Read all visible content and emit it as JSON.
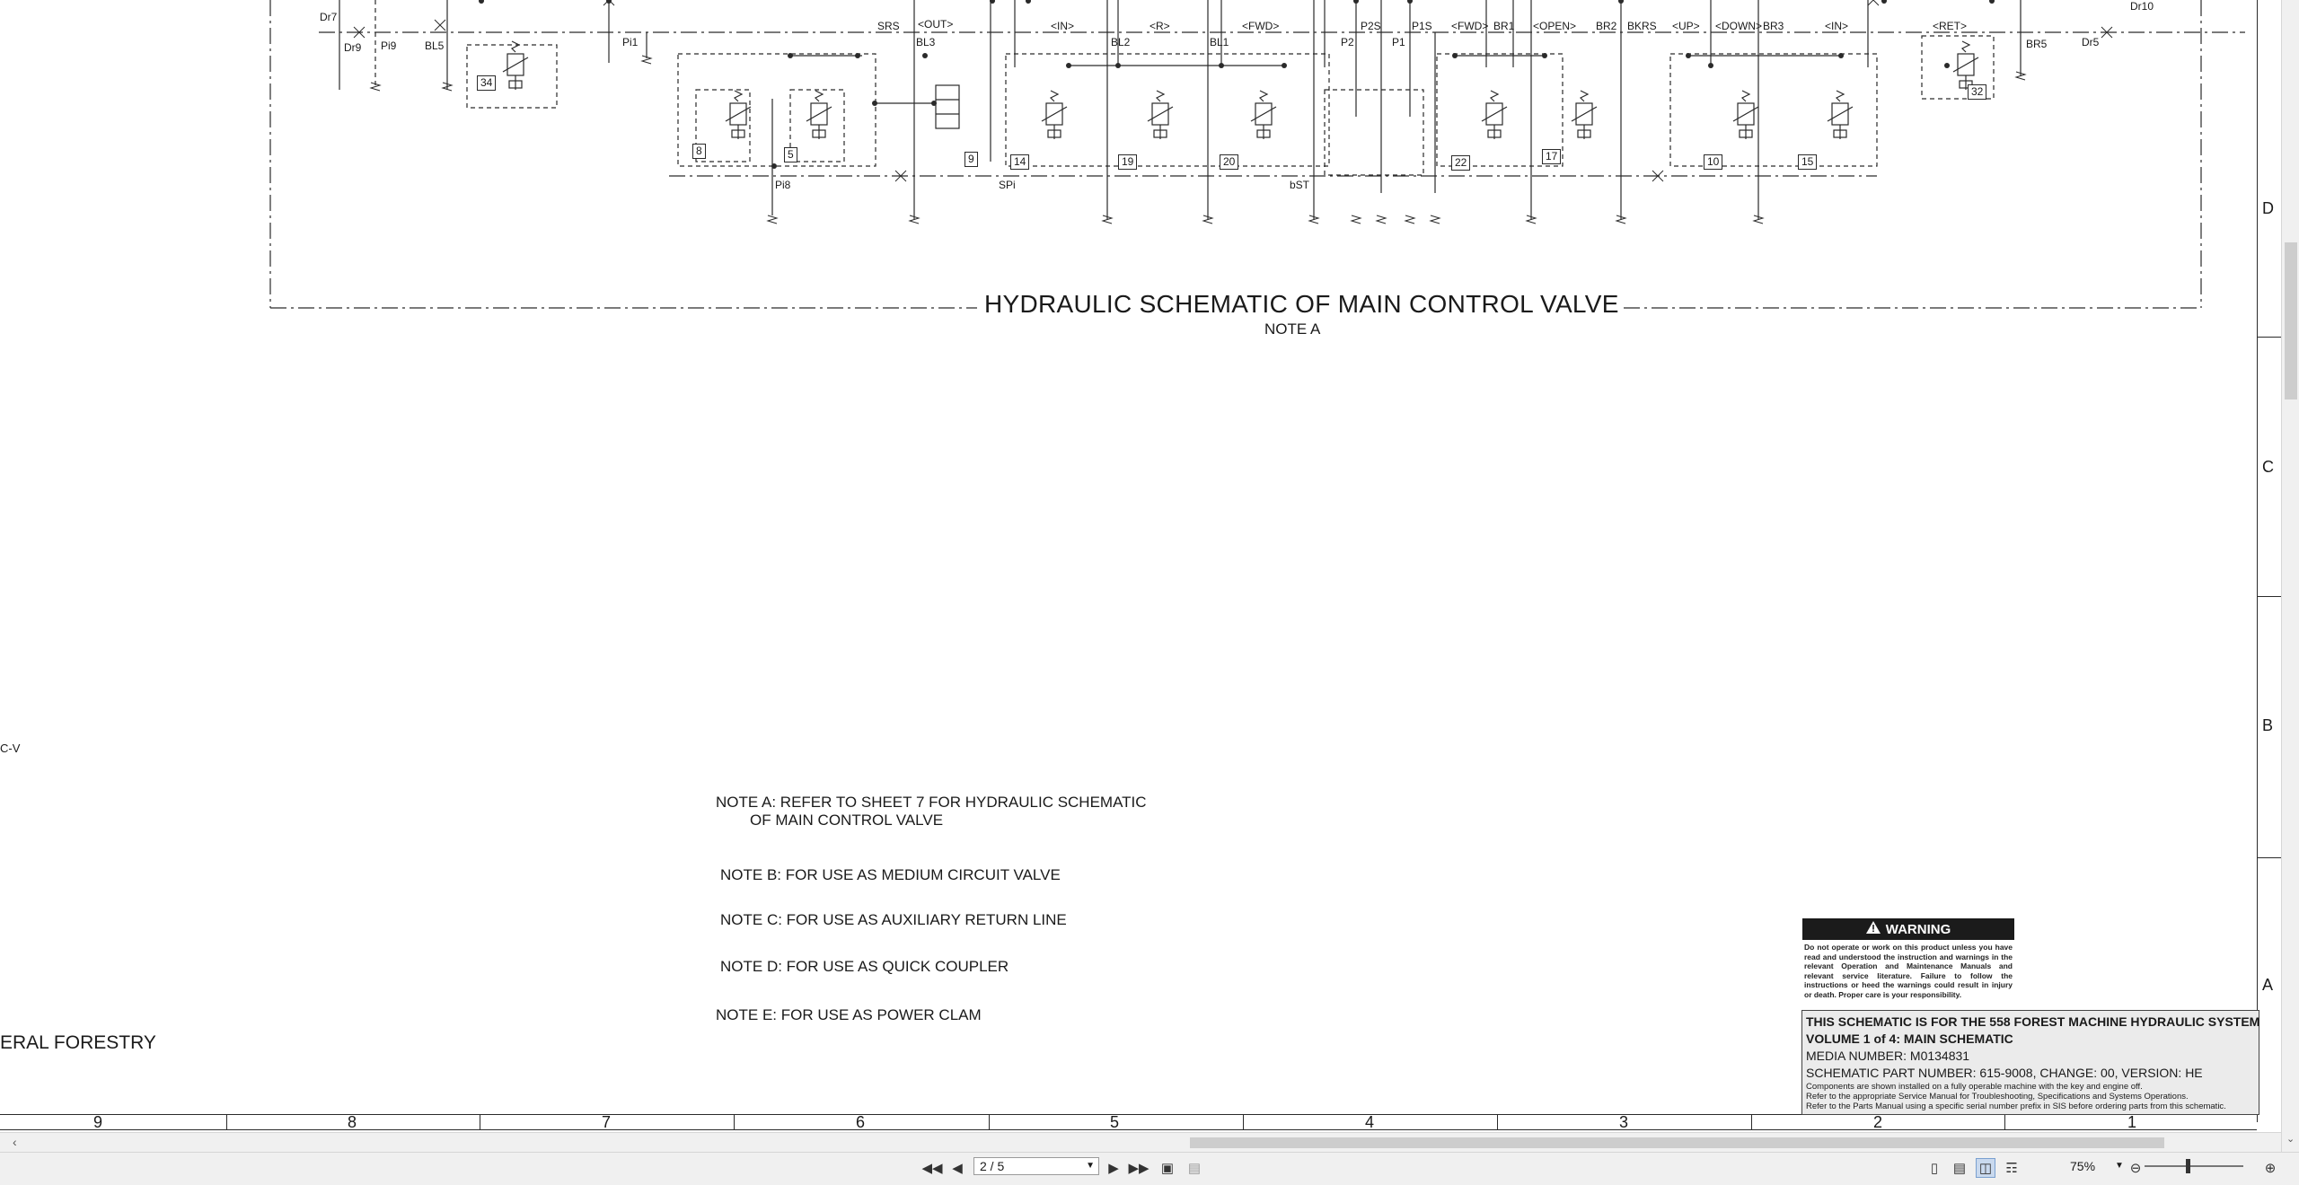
{
  "schematic": {
    "title": "HYDRAULIC SCHEMATIC OF MAIN CONTROL VALVE",
    "subtitle": "NOTE A",
    "port_labels": [
      "Dr7",
      "Dr9",
      "Pi9",
      "BL5",
      "Pi1",
      "SRS",
      "<OUT>",
      "BL3",
      "<IN>",
      "BL2",
      "<R>",
      "BL1",
      "<FWD>",
      "P2S",
      "P2",
      "P1S",
      "P1",
      "<FWD>",
      "BR1",
      "<OPEN>",
      "BR2",
      "BKRS",
      "<UP>",
      "<DOWN>",
      "BR3",
      "<IN>",
      "<RET>",
      "BR5",
      "Dr5",
      "Dr10",
      "Pi8",
      "SPi",
      "bST"
    ],
    "component_numbers": [
      "34",
      "8",
      "5",
      "9",
      "14",
      "19",
      "20",
      "22",
      "17",
      "10",
      "15",
      "32"
    ],
    "cut_text_left": "C-V",
    "cut_text_forestry": "ERAL FORESTRY"
  },
  "notes": [
    {
      "line1": "NOTE A: REFER TO SHEET 7 FOR HYDRAULIC SCHEMATIC",
      "line2": "OF MAIN CONTROL VALVE"
    },
    {
      "line1": "NOTE B: FOR USE AS MEDIUM CIRCUIT VALVE"
    },
    {
      "line1": "NOTE C: FOR USE AS AUXILIARY RETURN LINE"
    },
    {
      "line1": "NOTE D: FOR USE AS QUICK COUPLER"
    },
    {
      "line1": "NOTE E: FOR USE AS POWER CLAM"
    }
  ],
  "zones_right": [
    "D",
    "C",
    "B",
    "A"
  ],
  "columns": [
    "9",
    "8",
    "7",
    "6",
    "5",
    "4",
    "3",
    "2",
    "1"
  ],
  "warning": {
    "heading": "WARNING",
    "body": "Do not operate or work on this product unless you have read and understood the instruction and warnings in the relevant Operation and Maintenance Manuals and relevant service literature. Failure to follow the instructions or heed the warnings could result in injury or death. Proper care is your responsibility."
  },
  "info_block": {
    "title": "THIS SCHEMATIC IS FOR THE 558 FOREST MACHINE HYDRAULIC SYSTEM",
    "volume": "VOLUME 1 of 4: MAIN SCHEMATIC",
    "media": "MEDIA NUMBER: M0134831",
    "part": "SCHEMATIC PART NUMBER: 615-9008, CHANGE: 00, VERSION: HE",
    "small1": "Components are shown installed on a fully operable machine with the key and engine off.",
    "small2": "Refer to the appropriate Service Manual for Troubleshooting, Specifications and Systems Operations.",
    "small3": "Refer to the Parts Manual using a specific serial number prefix in SIS before ordering parts from this schematic."
  },
  "toolbar": {
    "page_value": "2 / 5",
    "zoom_value": "75%"
  },
  "colors": {
    "line": "#2a2a2a",
    "toolbar_bg": "#f0f0f0",
    "warning_bg": "#1b1b1b",
    "info_bg": "#ebebeb"
  }
}
